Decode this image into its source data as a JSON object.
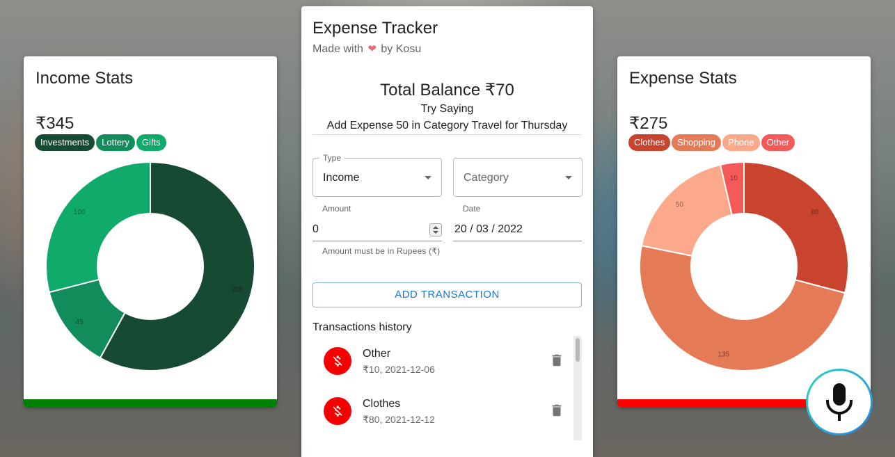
{
  "income": {
    "title": "Income Stats",
    "total": "₹345",
    "bar_color": "#008000",
    "categories": [
      {
        "name": "Investments",
        "color": "#164a32",
        "value": 200,
        "label": "200"
      },
      {
        "name": "Lottery",
        "color": "#118c5a",
        "value": 45,
        "label": "45"
      },
      {
        "name": "Gifts",
        "color": "#10ab6a",
        "value": 100,
        "label": "100"
      }
    ]
  },
  "expense": {
    "title": "Expense Stats",
    "total": "₹275",
    "bar_color": "#ff0000",
    "categories": [
      {
        "name": "Clothes",
        "color": "#c9442e",
        "value": 80,
        "label": "80"
      },
      {
        "name": "Shopping",
        "color": "#e57a57",
        "value": 135,
        "label": "135"
      },
      {
        "name": "Phone",
        "color": "#fca98b",
        "value": 50,
        "label": "50"
      },
      {
        "name": "Other",
        "color": "#f45a5a",
        "value": 10,
        "label": "10"
      }
    ]
  },
  "tracker": {
    "title": "Expense Tracker",
    "subtitle_prefix": "Made with",
    "subtitle_suffix": "by Kosu",
    "balance": "Total Balance ₹70",
    "hint_title": "Try Saying",
    "hint_text": "Add Expense 50 in Category Travel for Thursday",
    "type_legend": "Type",
    "type_value": "Income",
    "category_placeholder": "Category",
    "amount_label": "Amount",
    "amount_value": "0",
    "amount_helper": "Amount must be in Rupees (₹)",
    "date_label": "Date",
    "date_value": "20 / 03 / 2022",
    "add_button": "ADD TRANSACTION",
    "history_title": "Transactions history",
    "transactions": [
      {
        "category": "Other",
        "detail": "₹10, 2021-12-06"
      },
      {
        "category": "Clothes",
        "detail": "₹80, 2021-12-12"
      }
    ]
  },
  "colors": {
    "accent": "#1976d2",
    "expense_avatar": "#f50000"
  },
  "icons": {
    "transaction": "money-off-icon",
    "delete": "trash-icon",
    "voice": "microphone-icon",
    "heart": "heart-icon"
  }
}
